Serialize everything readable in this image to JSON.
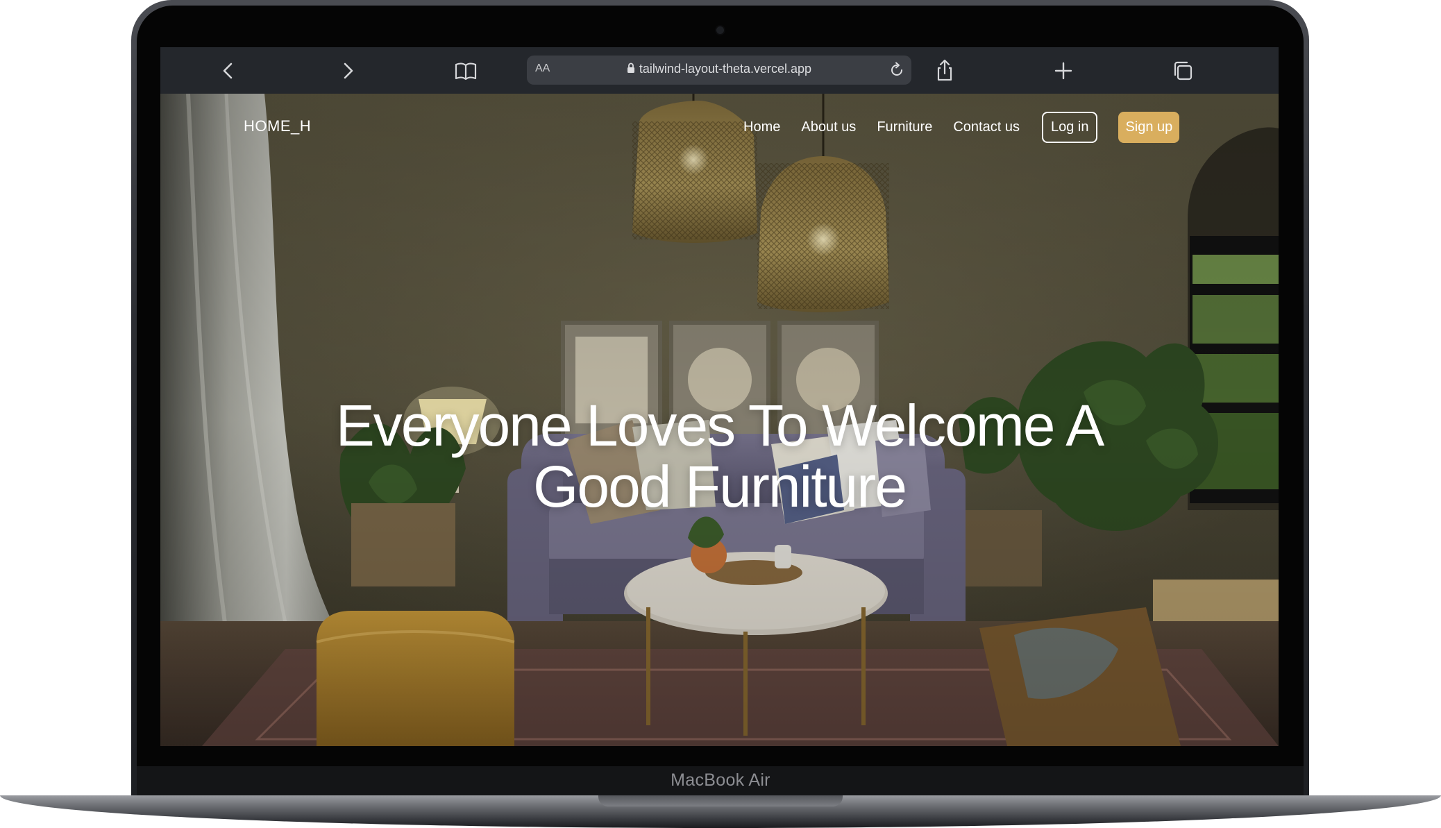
{
  "device": {
    "label": "MacBook Air"
  },
  "browser": {
    "text_size_label": "AA",
    "url": "tailwind-layout-theta.vercel.app",
    "icons": [
      "chevron-left-icon",
      "chevron-right-icon",
      "book-icon",
      "lock-icon",
      "reload-icon",
      "share-icon",
      "plus-icon",
      "tabs-icon"
    ]
  },
  "site": {
    "logo": "HOME_H",
    "nav": [
      {
        "label": "Home"
      },
      {
        "label": "About us"
      },
      {
        "label": "Furniture"
      },
      {
        "label": "Contact us"
      }
    ],
    "login_label": "Log in",
    "signup_label": "Sign up",
    "hero": {
      "line1": "Everyone Loves To Welcome A",
      "line2": "Good Furniture"
    },
    "colors": {
      "accent": "#d9ae5e",
      "wall": "#4a4636",
      "sofa": "#6e6a80"
    }
  }
}
